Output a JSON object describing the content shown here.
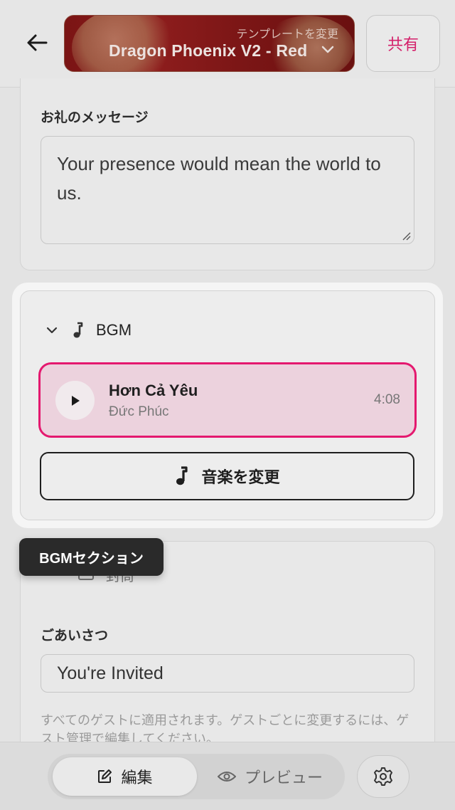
{
  "header": {
    "template_caption": "テンプレートを変更",
    "template_name": "Dragon Phoenix V2 - Red",
    "share_label": "共有"
  },
  "message_section": {
    "label": "お礼のメッセージ",
    "value": "Your presence would mean the world to us."
  },
  "bgm": {
    "title": "BGM",
    "song_title": "Hơn Cả Yêu",
    "song_artist": "Đức Phúc",
    "song_duration": "4:08",
    "change_label": "音楽を変更"
  },
  "tooltip": "BGMセクション",
  "cover": {
    "section_label": "封筒",
    "greeting_label": "ごあいさつ",
    "greeting_value": "You're Invited",
    "help_text": "すべてのゲストに適用されます。ゲストごとに変更するには、ゲスト管理で編集してください。"
  },
  "bottom_nav": {
    "edit_label": "編集",
    "preview_label": "プレビュー"
  },
  "colors": {
    "accent": "#e4196f",
    "song_bg": "#ecd2dd",
    "template_bg": "#7a1414"
  }
}
